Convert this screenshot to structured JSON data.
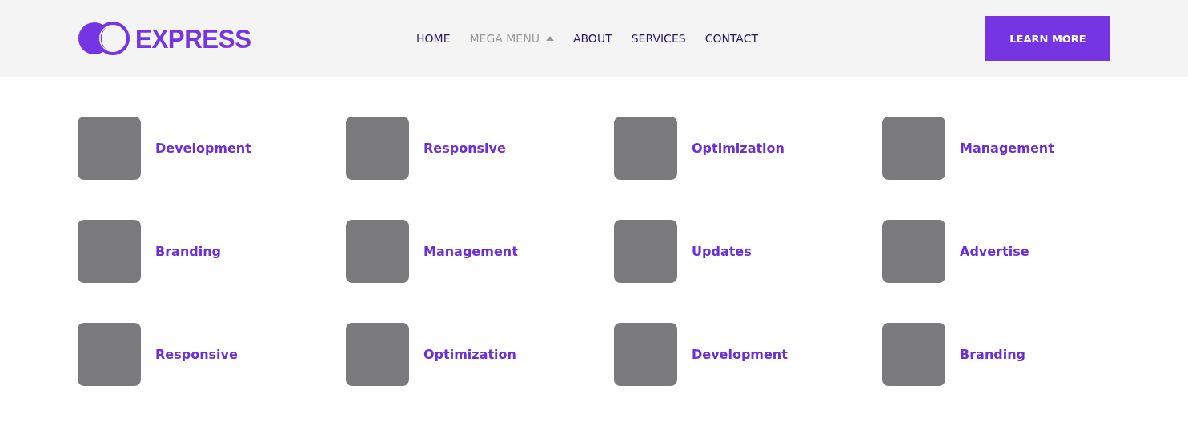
{
  "logo": {
    "text": "EXPRESS"
  },
  "nav": [
    {
      "label": "HOME",
      "selected": false,
      "kind": "link"
    },
    {
      "label": "MEGA MENU",
      "selected": true,
      "kind": "dropdown",
      "expanded": true
    },
    {
      "label": "ABOUT",
      "selected": false,
      "kind": "link"
    },
    {
      "label": "SERVICES",
      "selected": false,
      "kind": "link"
    },
    {
      "label": "CONTACT",
      "selected": false,
      "kind": "link"
    }
  ],
  "cta": {
    "label": "LEARN MORE"
  },
  "items": [
    {
      "label": "Development"
    },
    {
      "label": "Responsive"
    },
    {
      "label": "Optimization"
    },
    {
      "label": "Management"
    },
    {
      "label": "Branding"
    },
    {
      "label": "Management"
    },
    {
      "label": "Updates"
    },
    {
      "label": "Advertise"
    },
    {
      "label": "Responsive"
    },
    {
      "label": "Optimization"
    },
    {
      "label": "Development"
    },
    {
      "label": "Branding"
    }
  ]
}
